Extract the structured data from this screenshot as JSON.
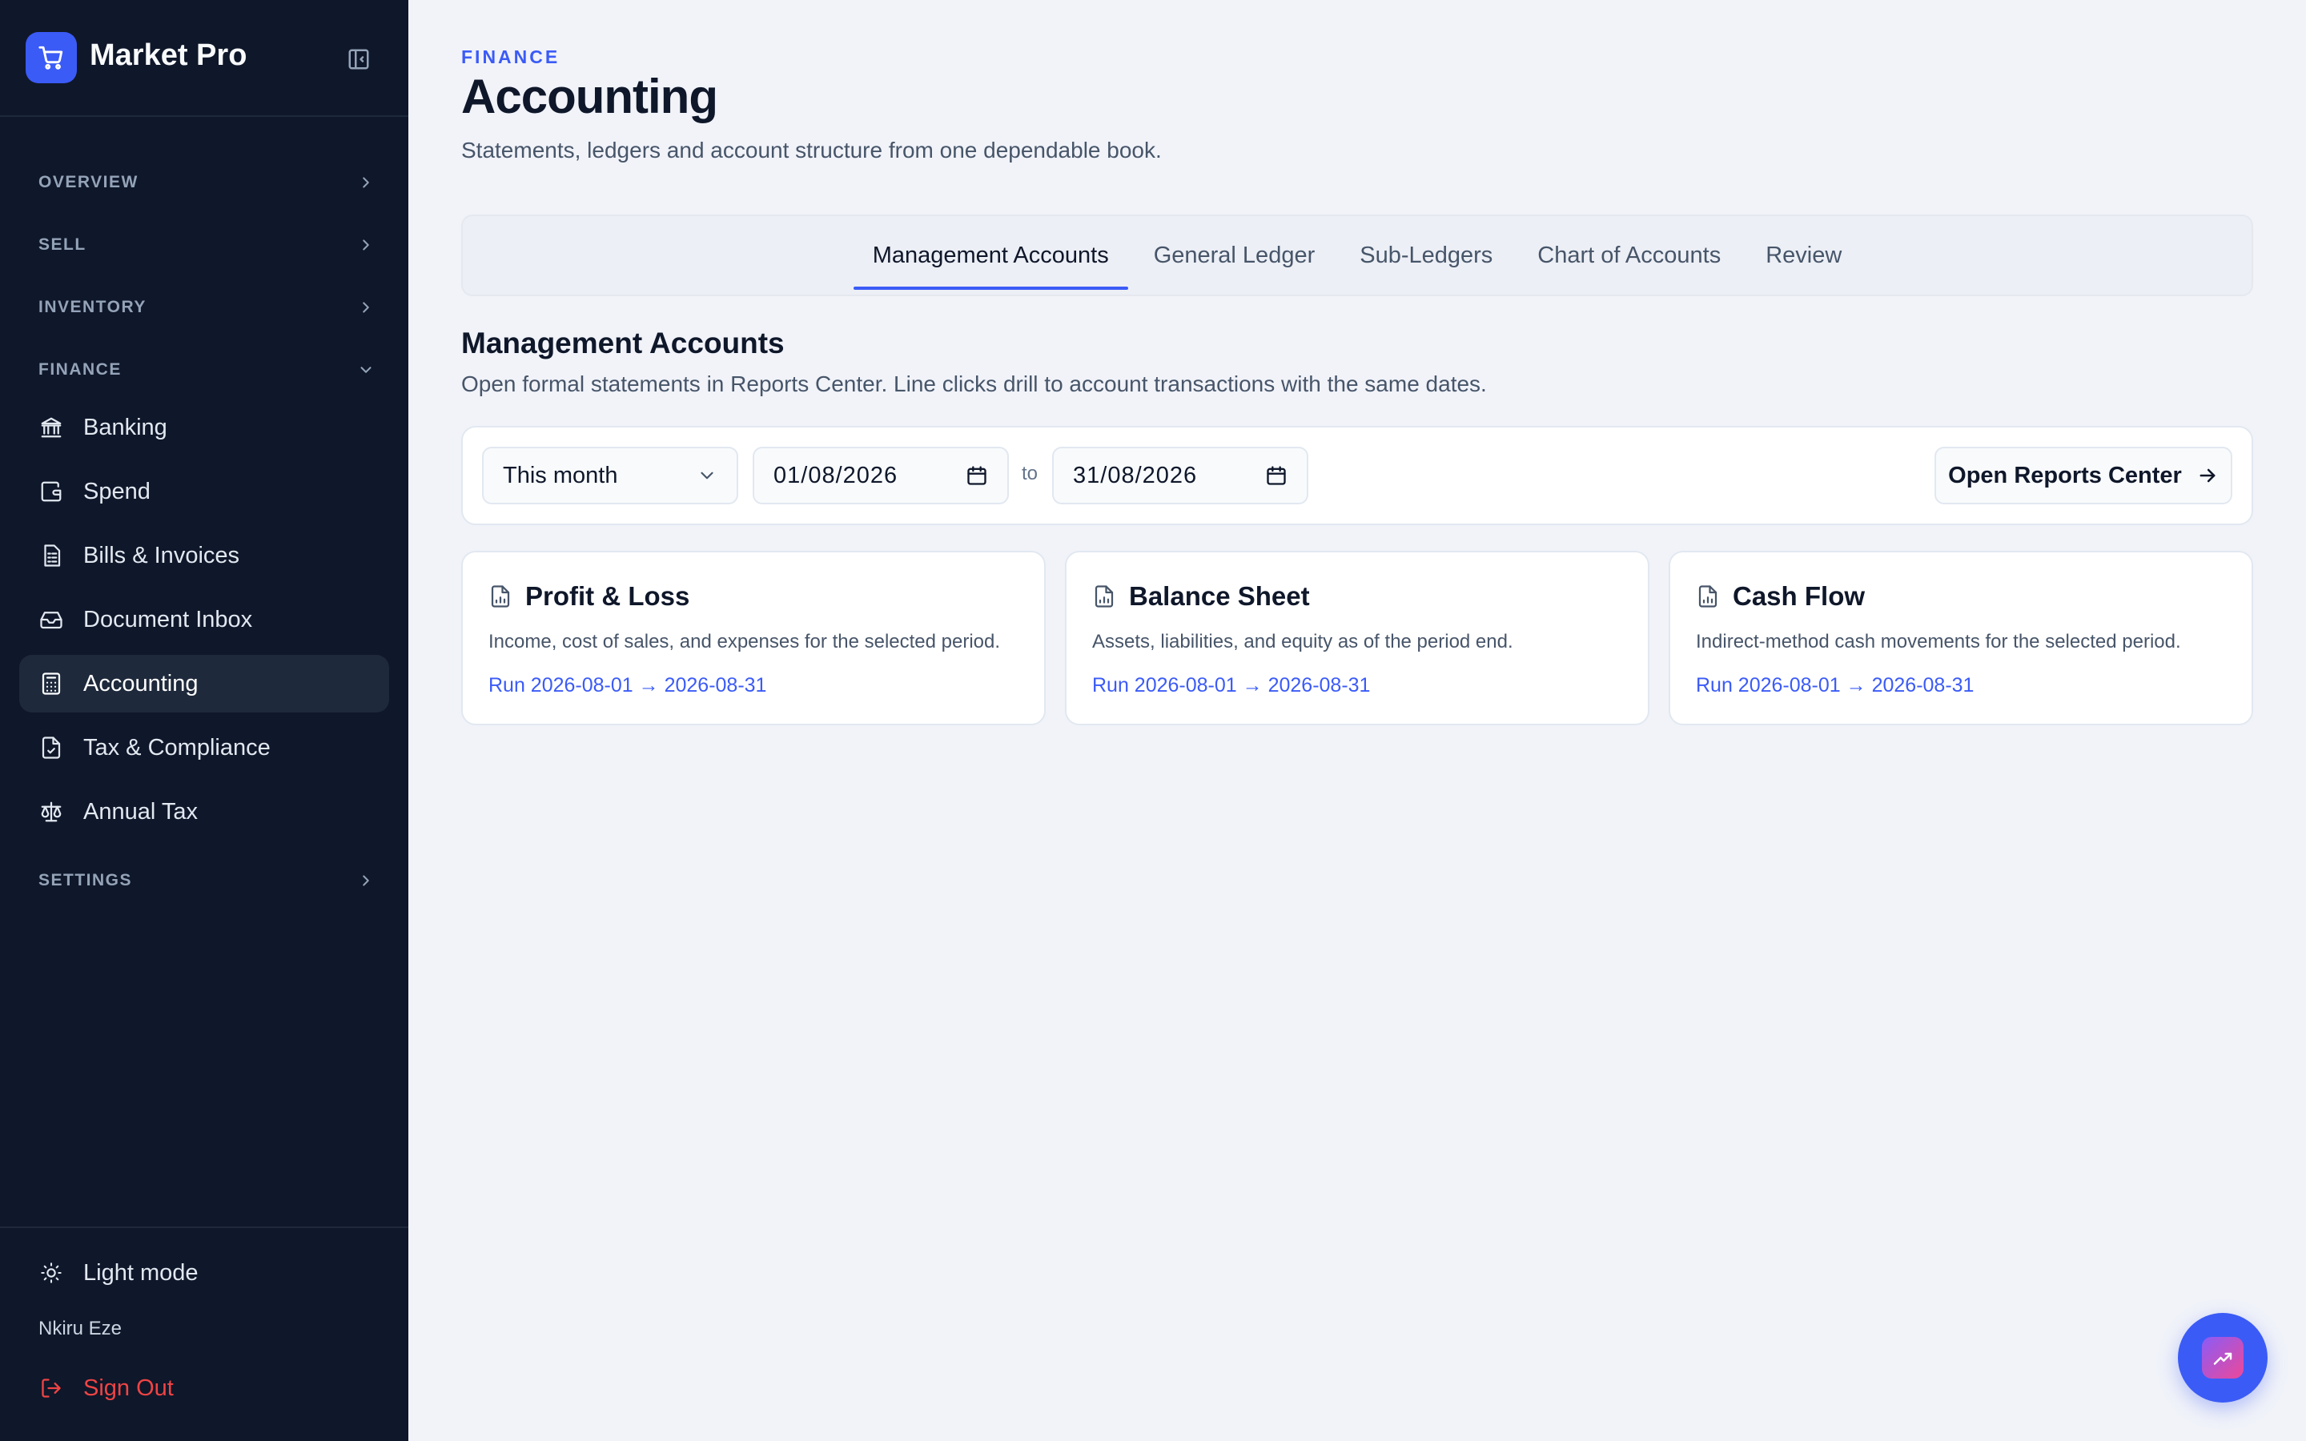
{
  "app": {
    "name": "Market Pro"
  },
  "sidebar": {
    "sections": [
      {
        "label": "OVERVIEW",
        "expanded": false
      },
      {
        "label": "SELL",
        "expanded": false
      },
      {
        "label": "INVENTORY",
        "expanded": false
      },
      {
        "label": "FINANCE",
        "expanded": true
      },
      {
        "label": "SETTINGS",
        "expanded": false
      }
    ],
    "finance_items": [
      {
        "label": "Banking",
        "icon": "bank-icon"
      },
      {
        "label": "Spend",
        "icon": "wallet-icon"
      },
      {
        "label": "Bills & Invoices",
        "icon": "receipt-icon"
      },
      {
        "label": "Document Inbox",
        "icon": "inbox-icon"
      },
      {
        "label": "Accounting",
        "icon": "calculator-icon",
        "active": true
      },
      {
        "label": "Tax & Compliance",
        "icon": "file-check-icon"
      },
      {
        "label": "Annual Tax",
        "icon": "scale-icon"
      }
    ],
    "footer": {
      "mode_label": "Light mode",
      "user_name": "Nkiru Eze",
      "signout_label": "Sign Out"
    }
  },
  "header": {
    "eyebrow": "FINANCE",
    "title": "Accounting",
    "subtitle": "Statements, ledgers and account structure from one dependable book."
  },
  "tabs": [
    {
      "label": "Management Accounts",
      "active": true
    },
    {
      "label": "General Ledger"
    },
    {
      "label": "Sub-Ledgers"
    },
    {
      "label": "Chart of Accounts"
    },
    {
      "label": "Review"
    }
  ],
  "section": {
    "title": "Management Accounts",
    "subtitle": "Open formal statements in Reports Center. Line clicks drill to account transactions with the same dates."
  },
  "filters": {
    "period": "This month",
    "from_date": "01/08/2026",
    "to_label": "to",
    "to_date": "31/08/2026",
    "open_button": "Open Reports Center"
  },
  "cards": [
    {
      "title": "Profit & Loss",
      "desc": "Income, cost of sales, and expenses for the selected period.",
      "link": "Run 2026-08-01 → 2026-08-31"
    },
    {
      "title": "Balance Sheet",
      "desc": "Assets, liabilities, and equity as of the period end.",
      "link": "Run 2026-08-01 → 2026-08-31"
    },
    {
      "title": "Cash Flow",
      "desc": "Indirect-method cash movements for the selected period.",
      "link": "Run 2026-08-01 → 2026-08-31"
    }
  ],
  "colors": {
    "accent": "#3b5bf6",
    "sidebar_bg": "#0f172a",
    "danger": "#ef4444"
  }
}
